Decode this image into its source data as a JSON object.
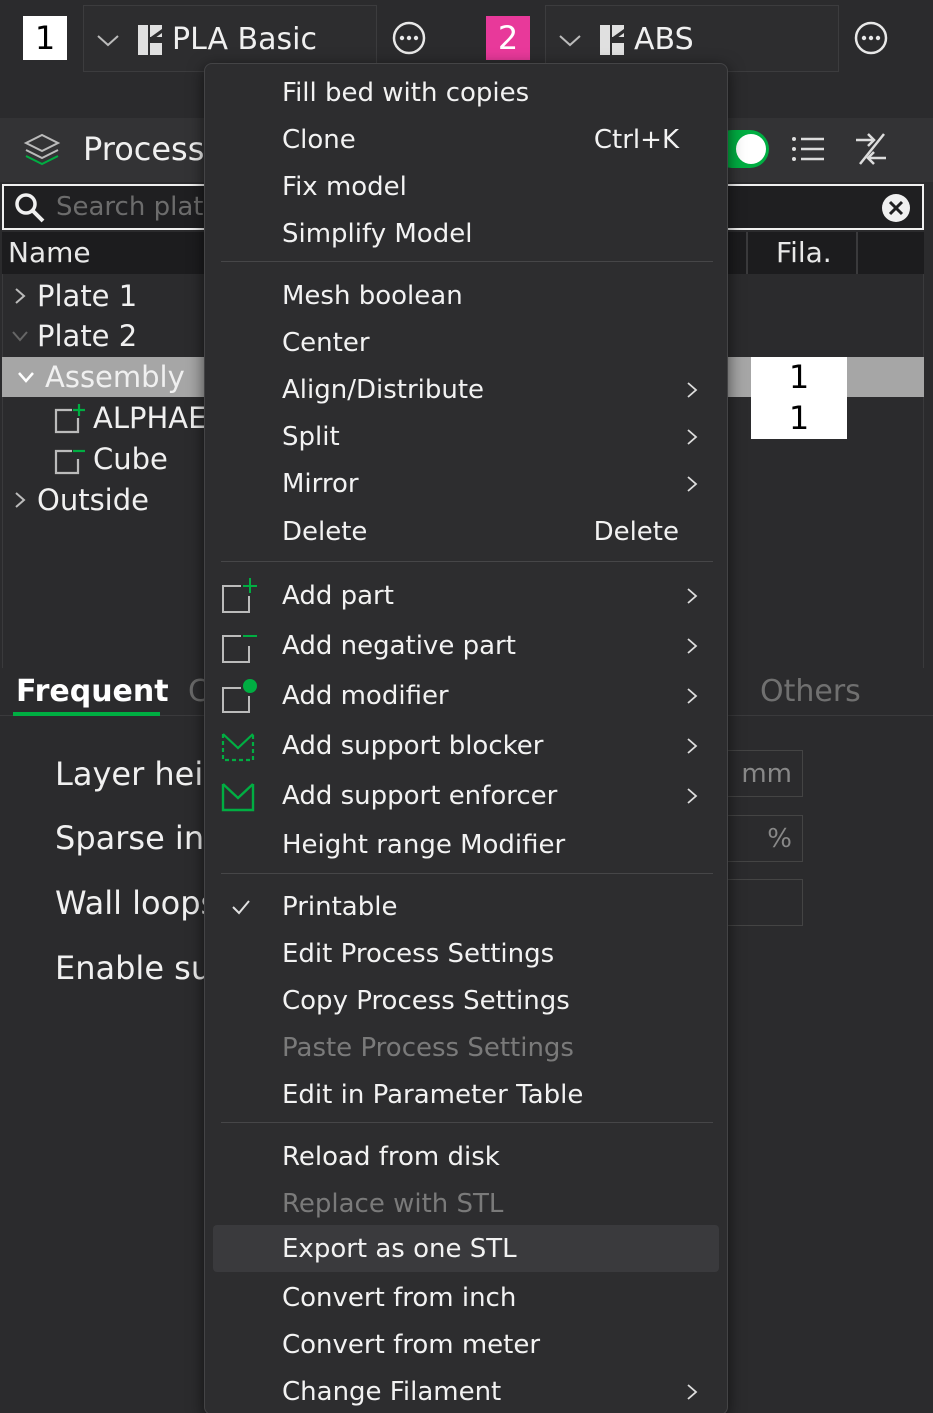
{
  "filaments": [
    {
      "index": "1",
      "name": "PLA Basic"
    },
    {
      "index": "2",
      "name": "ABS"
    }
  ],
  "process": {
    "title": "Process"
  },
  "search": {
    "placeholder": "Search plate,"
  },
  "table": {
    "name_header": "Name",
    "fila_header": "Fila."
  },
  "tree": {
    "plate1": "Plate 1",
    "plate2": "Plate 2",
    "assembly": "Assembly",
    "alphabet": "ALPHAE",
    "cube": "Cube",
    "outside": "Outside",
    "fila_values": [
      "1",
      "1"
    ]
  },
  "tabs": {
    "frequent": "Frequent",
    "c": "C",
    "others": "Others"
  },
  "settings": {
    "layer_height": "Layer heig",
    "sparse_infill": "Sparse inf",
    "wall_loops": "Wall loops",
    "enable_support": "Enable su",
    "unit_mm": "mm",
    "unit_pct": "%"
  },
  "menu": {
    "items": [
      {
        "label": "Fill bed with copies"
      },
      {
        "label": "Clone",
        "shortcut": "Ctrl+K"
      },
      {
        "label": "Fix model"
      },
      {
        "label": "Simplify Model"
      },
      {
        "label": "Mesh boolean"
      },
      {
        "label": "Center"
      },
      {
        "label": "Align/Distribute"
      },
      {
        "label": "Split"
      },
      {
        "label": "Mirror"
      },
      {
        "label": "Delete",
        "shortcut": "Delete"
      },
      {
        "label": "Add part"
      },
      {
        "label": "Add negative part"
      },
      {
        "label": "Add modifier"
      },
      {
        "label": "Add support blocker"
      },
      {
        "label": "Add support enforcer"
      },
      {
        "label": "Height range Modifier"
      },
      {
        "label": "Printable"
      },
      {
        "label": "Edit Process Settings"
      },
      {
        "label": "Copy Process Settings"
      },
      {
        "label": "Paste Process Settings"
      },
      {
        "label": "Edit in Parameter Table"
      },
      {
        "label": "Reload from disk"
      },
      {
        "label": "Replace with STL"
      },
      {
        "label": "Export as one STL"
      },
      {
        "label": "Convert from inch"
      },
      {
        "label": "Convert from meter"
      },
      {
        "label": "Change Filament"
      }
    ]
  },
  "colors": {
    "accent": "#00ae42",
    "filament2": "#e8399a",
    "selection": "#a6a6a6"
  }
}
